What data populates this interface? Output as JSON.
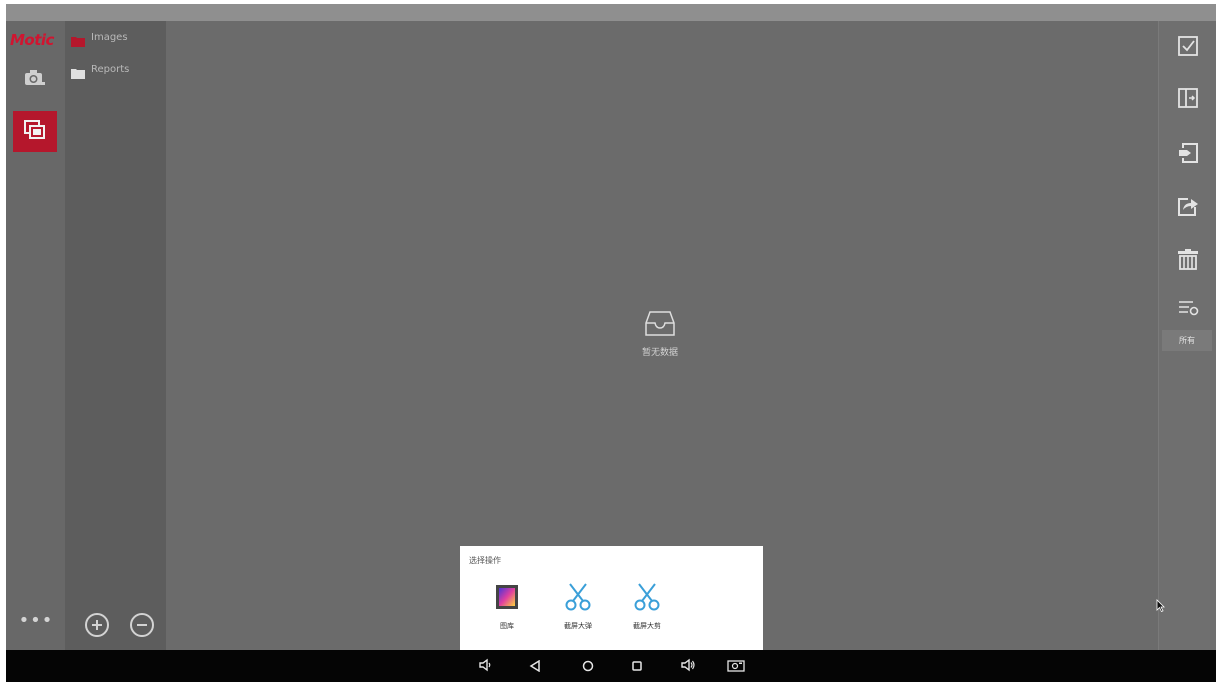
{
  "app": {
    "logo": "Motic"
  },
  "left_rail": {
    "more": "•••"
  },
  "folders": [
    {
      "label": "Images",
      "icon": "folder-icon",
      "color": "#b5172c"
    },
    {
      "label": "Reports",
      "icon": "folder-icon",
      "color": "#e0e0e0"
    }
  ],
  "content": {
    "empty_text": "暂无数据"
  },
  "right_toolbar": {
    "icons": [
      "select-all-icon",
      "import-icon",
      "export-icon",
      "share-icon",
      "delete-icon",
      "filter-settings-icon"
    ],
    "filter_value": "所有"
  },
  "dialog": {
    "title": "选择操作",
    "options": [
      {
        "label": "图库",
        "icon": "gallery-icon"
      },
      {
        "label": "截屏大弹",
        "icon": "scissors-icon"
      },
      {
        "label": "截屏大剪",
        "icon": "scissors-icon"
      }
    ]
  },
  "nav_bar": {
    "buttons": [
      "volume-down-icon",
      "back-icon",
      "home-icon",
      "recents-icon",
      "volume-up-icon",
      "screenshot-icon"
    ]
  },
  "colors": {
    "accent": "#b5172c",
    "logo": "#d01530",
    "scissors": "#3a9fd8"
  }
}
